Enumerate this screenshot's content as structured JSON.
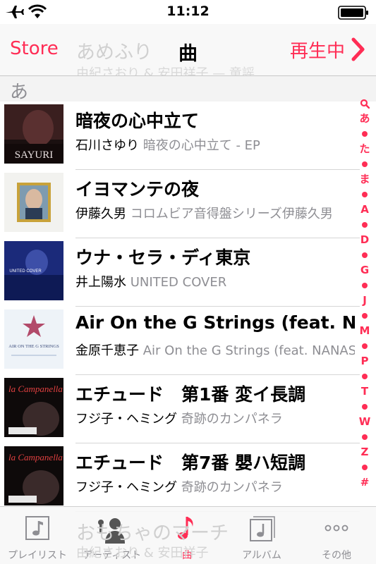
{
  "status_bar": {
    "time": "11:12"
  },
  "nav": {
    "back_label": "Store",
    "title": "曲",
    "now_playing_label": "再生中",
    "behind_title": "あめふり",
    "behind_subtitle": "由紀さおり & 安田祥子 — 童謡"
  },
  "section": {
    "header": "あ"
  },
  "songs": [
    {
      "title": "暗夜の心中立て",
      "artist": "石川さゆり",
      "album": "暗夜の心中立て - EP",
      "art_text": "SAYURI"
    },
    {
      "title": "イヨマンテの夜",
      "artist": "伊藤久男",
      "album": "コロムビア音得盤シリーズ伊藤久男",
      "art_text": ""
    },
    {
      "title": "ウナ・セラ・ディ東京",
      "artist": "井上陽水",
      "album": "UNITED COVER",
      "art_text": "UNITED COVER"
    },
    {
      "title": "Air On the G Strings (feat. NANASE)",
      "artist": "金原千恵子",
      "album": "Air On the G Strings (feat. NANASE)",
      "art_text": "AIR ON THE G STRINGS"
    },
    {
      "title": "エチュード　第1番 変イ長調",
      "artist": "フジ子・ヘミング",
      "album": "奇跡のカンパネラ",
      "art_text": "la Campanella"
    },
    {
      "title": "エチュード　第7番 嬰ハ短調",
      "artist": "フジ子・ヘミング",
      "album": "奇跡のカンパネラ",
      "art_text": "la Campanella"
    }
  ],
  "index": [
    "search",
    "あ",
    "dot",
    "た",
    "dot",
    "ま",
    "dot",
    "A",
    "dot",
    "D",
    "dot",
    "G",
    "dot",
    "J",
    "dot",
    "M",
    "dot",
    "P",
    "dot",
    "T",
    "dot",
    "W",
    "dot",
    "Z",
    "dot",
    "#"
  ],
  "mini_player": {
    "title": "おもちゃのマーチ",
    "subtitle": "由紀さおり & 安田祥子"
  },
  "tabs": [
    {
      "label": "プレイリスト",
      "icon": "playlist-icon"
    },
    {
      "label": "アーティスト",
      "icon": "artist-icon"
    },
    {
      "label": "曲",
      "icon": "music-note-icon",
      "active": true
    },
    {
      "label": "アルバム",
      "icon": "album-icon"
    },
    {
      "label": "その他",
      "icon": "more-icon"
    }
  ],
  "colors": {
    "accent": "#ff2d55",
    "secondary_text": "#8e8e93"
  }
}
